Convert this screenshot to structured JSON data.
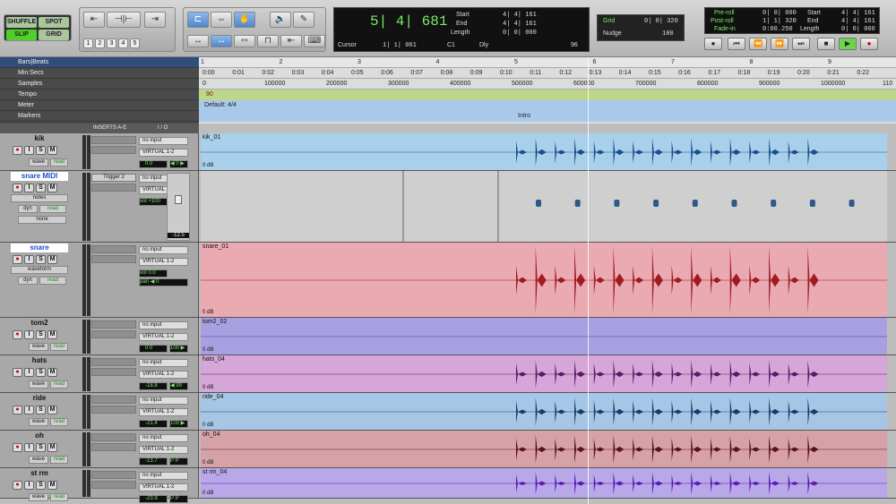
{
  "edit_modes": {
    "shuffle": "SHUFFLE",
    "spot": "SPOT",
    "slip": "SLIP",
    "grid": "GRID"
  },
  "zoom_presets": [
    "1",
    "2",
    "3",
    "4",
    "5"
  ],
  "counter": {
    "main": "5| 4| 681",
    "start_label": "Start",
    "end_label": "End",
    "length_label": "Length",
    "start": "4| 4| 161",
    "end": "4| 4| 161",
    "length": "0| 0| 000",
    "cursor_label": "Cursor",
    "cursor": "1| 1| 061",
    "c1": "C1",
    "dly": "Dly",
    "bpm": "96"
  },
  "grid": {
    "label": "Grid",
    "value": "0| 0| 320",
    "nudge_label": "Nudge",
    "nudge_value": "100"
  },
  "transport": {
    "preroll_label": "Pre-roll",
    "postroll_label": "Post-roll",
    "fadein_label": "Fade-in",
    "preroll": "0| 0| 000",
    "postroll": "1| 1| 320",
    "fadein": "0:00.250",
    "start_label": "Start",
    "end_label": "End",
    "length_label": "Length",
    "start": "4| 4| 161",
    "end": "4| 4| 161",
    "length": "0| 0| 000"
  },
  "rulers": {
    "bars": "Bars|Beats",
    "minsecs": "Min:Secs",
    "samples": "Samples",
    "tempo": "Tempo",
    "meter": "Meter",
    "markers": "Markers",
    "bar_ticks": [
      "1",
      "2",
      "3",
      "4",
      "5",
      "6",
      "7",
      "8",
      "9"
    ],
    "min_ticks": [
      "0:00",
      "0:01",
      "0:02",
      "0:03",
      "0:04",
      "0:05",
      "0:06",
      "0:07",
      "0:08",
      "0:09",
      "0:10",
      "0:11",
      "0:12",
      "0:13",
      "0:14",
      "0:15",
      "0:16",
      "0:17",
      "0:18",
      "0:19",
      "0:20",
      "0:21",
      "0:22"
    ],
    "sample_ticks": [
      "0",
      "100000",
      "200000",
      "300000",
      "400000",
      "500000",
      "600000",
      "700000",
      "800000",
      "900000",
      "1000000",
      "110"
    ],
    "tempo_value": "90",
    "meter_value": "Default: 4/4",
    "marker_value": "Intro"
  },
  "columns": {
    "inserts": "INSERTS A-E",
    "io": "I / O"
  },
  "tracks": [
    {
      "name": "kik",
      "view": "wave",
      "mode": "read",
      "input": "no input",
      "output": "VIRTUAL 1-2",
      "vol": "0.0",
      "pan": "◀ 0 ▶",
      "clip": "kik_01",
      "gain": "0 dB",
      "color": "#a9d0ea",
      "wave": "#1a4f8c"
    },
    {
      "name": "snare MIDI",
      "view": "notes",
      "mode": "read",
      "dyn": "dyn",
      "none": "none",
      "insert": "Trigger 2",
      "input": "no input",
      "output": "VIRTUAL 1-2",
      "vol_label": "vol",
      "vol": "+100",
      "fader": "-12.5",
      "color": "#cfcfcf"
    },
    {
      "name": "snare",
      "view": "waveform",
      "mode": "read",
      "dyn": "dyn",
      "input": "no input",
      "output": "VIRTUAL 1-2",
      "vol_label": "vol",
      "vol": "0.0",
      "pan_label": "pan",
      "pan": "◀ 0",
      "clip": "snare_01",
      "gain": "0 dB",
      "color": "#eaaab2",
      "wave": "#a01a22"
    },
    {
      "name": "tom2",
      "view": "wave",
      "mode": "read",
      "input": "no input",
      "output": "VIRTUAL 1-2",
      "vol": "0.0",
      "pan": "100 ▶",
      "clip": "tom2_02",
      "gain": "0 dB",
      "color": "#a9a0e2",
      "wave": "#4a3a9a"
    },
    {
      "name": "hats",
      "view": "wave",
      "mode": "read",
      "input": "no input",
      "output": "VIRTUAL 1-2",
      "vol": "-18.8",
      "pan": "◀ 99",
      "clip": "hats_04",
      "gain": "0 dB",
      "color": "#d6a6d8",
      "wave": "#5a1a6a"
    },
    {
      "name": "ride",
      "view": "wave",
      "mode": "read",
      "input": "no input",
      "output": "VIRTUAL 1-2",
      "vol": "-21.4",
      "pan": "100 ▶",
      "clip": "ride_04",
      "gain": "0 dB",
      "color": "#a6c6e6",
      "wave": "#1a3a6a"
    },
    {
      "name": "oh",
      "view": "wave",
      "mode": "read",
      "input": "no input",
      "output": "VIRTUAL 1-2",
      "vol": "-13.7",
      "pan": "P P",
      "clip": "oh_04",
      "gain": "0 dB",
      "color": "#d6a2a8",
      "wave": "#5a1020"
    },
    {
      "name": "st rm",
      "view": "wave",
      "mode": "read",
      "input": "no input",
      "output": "VIRTUAL 1-2",
      "vol": "-23.9",
      "pan": "P P",
      "clip": "st rm_04",
      "gain": "0 dB",
      "color": "#b8a8e8",
      "wave": "#5a1ab8"
    }
  ]
}
